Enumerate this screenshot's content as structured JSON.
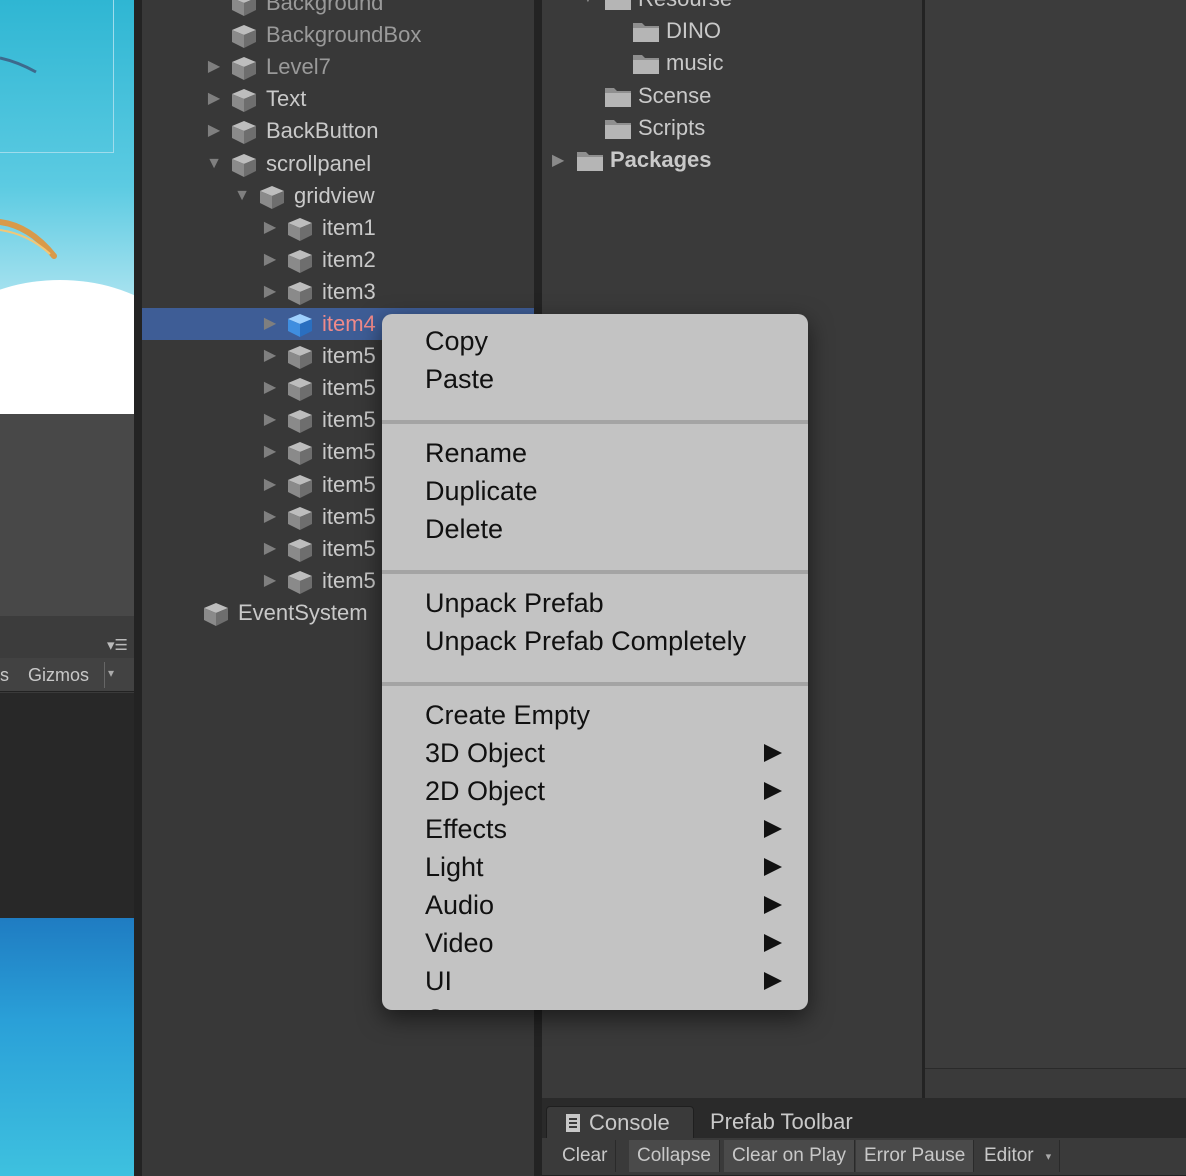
{
  "scene": {
    "options_fragment": "s",
    "gizmos_label": "Gizmos"
  },
  "hierarchy": {
    "items": [
      {
        "label": "Background",
        "indent": 0,
        "arrow": "none",
        "dim": true
      },
      {
        "label": "BackgroundBox",
        "indent": 0,
        "arrow": "none",
        "dim": true
      },
      {
        "label": "Level7",
        "indent": 0,
        "arrow": "collapsed",
        "dim": true
      },
      {
        "label": "Text",
        "indent": 0,
        "arrow": "collapsed"
      },
      {
        "label": "BackButton",
        "indent": 0,
        "arrow": "collapsed"
      },
      {
        "label": "scrollpanel",
        "indent": 0,
        "arrow": "expanded"
      },
      {
        "label": "gridview",
        "indent": 1,
        "arrow": "expanded"
      },
      {
        "label": "item1",
        "indent": 2,
        "arrow": "collapsed"
      },
      {
        "label": "item2",
        "indent": 2,
        "arrow": "collapsed"
      },
      {
        "label": "item3",
        "indent": 2,
        "arrow": "collapsed"
      },
      {
        "label": "item4",
        "indent": 2,
        "arrow": "collapsed",
        "selected": true
      },
      {
        "label": "item5",
        "indent": 2,
        "arrow": "collapsed"
      },
      {
        "label": "item5",
        "indent": 2,
        "arrow": "collapsed"
      },
      {
        "label": "item5",
        "indent": 2,
        "arrow": "collapsed"
      },
      {
        "label": "item5",
        "indent": 2,
        "arrow": "collapsed"
      },
      {
        "label": "item5",
        "indent": 2,
        "arrow": "collapsed"
      },
      {
        "label": "item5",
        "indent": 2,
        "arrow": "collapsed"
      },
      {
        "label": "item5",
        "indent": 2,
        "arrow": "collapsed"
      },
      {
        "label": "item5",
        "indent": 2,
        "arrow": "collapsed"
      },
      {
        "label": "EventSystem",
        "indent": -1,
        "arrow": "none"
      }
    ]
  },
  "project": {
    "items": [
      {
        "label": "Resourse",
        "level": 1,
        "arrow": "expanded"
      },
      {
        "label": "DINO",
        "level": 2,
        "arrow": "none"
      },
      {
        "label": "music",
        "level": 2,
        "arrow": "none"
      },
      {
        "label": "Scense",
        "level": 1,
        "arrow": "none"
      },
      {
        "label": "Scripts",
        "level": 1,
        "arrow": "none"
      },
      {
        "label": "Packages",
        "level": 0,
        "arrow": "collapsed",
        "bold": true
      }
    ]
  },
  "console": {
    "tabs": [
      {
        "label": "Console",
        "active": true
      },
      {
        "label": "Prefab Toolbar",
        "active": false
      }
    ],
    "toolbar": {
      "clear": "Clear",
      "collapse": "Collapse",
      "clear_on_play": "Clear on Play",
      "error_pause": "Error Pause",
      "editor": "Editor"
    }
  },
  "context_menu": {
    "groups": [
      [
        {
          "label": "Copy"
        },
        {
          "label": "Paste"
        }
      ],
      [
        {
          "label": "Rename"
        },
        {
          "label": "Duplicate"
        },
        {
          "label": "Delete"
        }
      ],
      [
        {
          "label": "Unpack Prefab"
        },
        {
          "label": "Unpack Prefab Completely"
        }
      ],
      [
        {
          "label": "Create Empty",
          "submenu": false
        },
        {
          "label": "3D Object",
          "submenu": true
        },
        {
          "label": "2D Object",
          "submenu": true
        },
        {
          "label": "Effects",
          "submenu": true
        },
        {
          "label": "Light",
          "submenu": true
        },
        {
          "label": "Audio",
          "submenu": true
        },
        {
          "label": "Video",
          "submenu": true
        },
        {
          "label": "UI",
          "submenu": true
        },
        {
          "label": "Camera",
          "submenu": false
        }
      ]
    ]
  },
  "colors": {
    "selection": "#3e5d96",
    "selected_text": "#f08a8a",
    "menu_bg": "#c3c3c3",
    "panel_bg": "#383838"
  }
}
